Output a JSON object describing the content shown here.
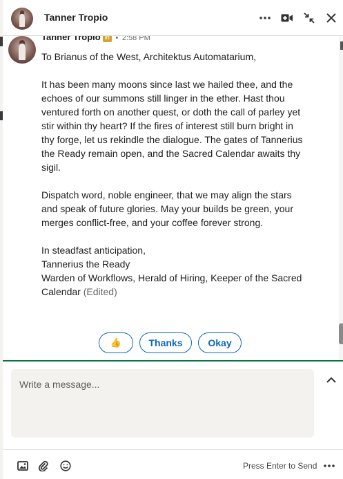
{
  "header": {
    "name": "Tanner Tropio"
  },
  "message": {
    "sender": "Tanner Tropio",
    "time": "2:58 PM",
    "greeting": "To Brianus of the West, Architektus Automatarium,",
    "paragraph1": "It has been many moons since last we hailed thee, and the echoes of our summons still linger in the ether. Hast thou ventured forth on another quest, or doth the call of parley yet stir within thy heart? If the fires of interest still burn bright in thy forge, let us rekindle the dialogue. The gates of Tannerius the Ready remain open, and the Sacred Calendar awaits thy sigil.",
    "paragraph2": "Dispatch word, noble engineer, that we may align the stars and speak of future glories. May your builds be green, your merges conflict-free, and your coffee forever strong.",
    "closing": "In steadfast anticipation,",
    "signature_name": "Tannerius the Ready",
    "signature_title": "Warden of Workflows, Herald of Hiring, Keeper of the Sacred Calendar",
    "edited_label": "(Edited)"
  },
  "quick_replies": {
    "thumbs": "👍",
    "thanks": "Thanks",
    "okay": "Okay"
  },
  "composer": {
    "placeholder": "Write a message...",
    "value": ""
  },
  "footer": {
    "press_enter_label": "Press Enter to Send"
  },
  "colors": {
    "accent": "#0a66c2",
    "divider_green": "#057642",
    "composer_bg": "#f3f2ef"
  }
}
